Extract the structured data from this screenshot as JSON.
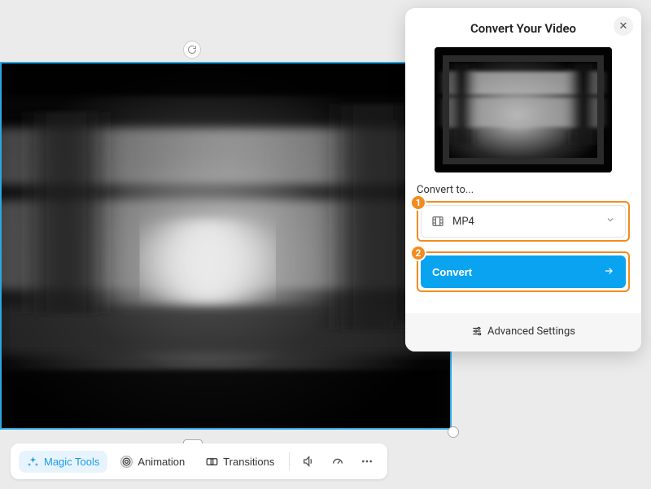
{
  "panel": {
    "title": "Convert Your Video",
    "section_label": "Convert to...",
    "selected_format": "MP4",
    "convert_label": "Convert",
    "advanced_label": "Advanced Settings",
    "step1": "1",
    "step2": "2"
  },
  "toolbar": {
    "magic_tools": "Magic Tools",
    "animation": "Animation",
    "transitions": "Transitions"
  }
}
